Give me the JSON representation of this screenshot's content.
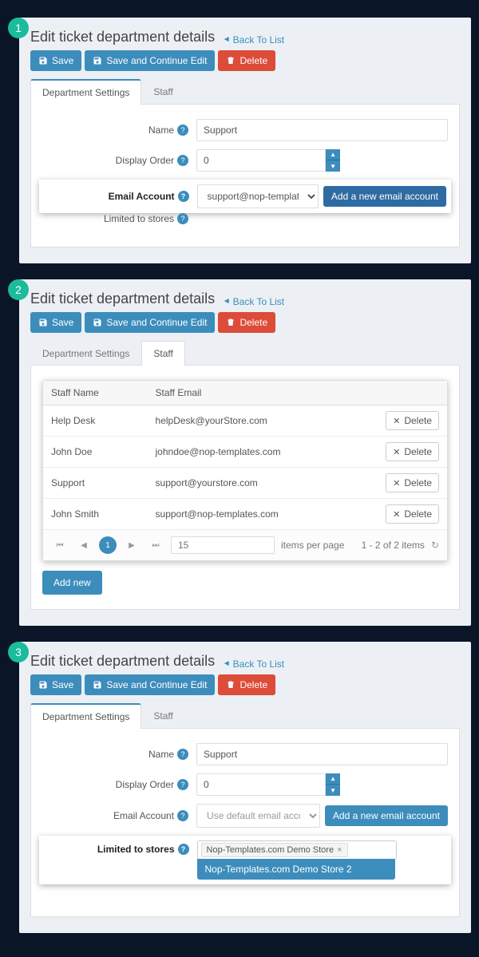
{
  "common": {
    "page_title": "Edit ticket department details",
    "back_link": "Back To List",
    "save": "Save",
    "save_continue": "Save and Continue Edit",
    "delete": "Delete",
    "tab_settings": "Department Settings",
    "tab_staff": "Staff",
    "label_name": "Name",
    "label_display_order": "Display Order",
    "label_email_account": "Email Account",
    "label_limited_stores": "Limited to stores",
    "btn_add_email": "Add a new email account"
  },
  "p1": {
    "num": "1",
    "name_value": "Support",
    "display_order": "0",
    "email_select": "support@nop-templates.com"
  },
  "p2": {
    "num": "2",
    "col_name": "Staff Name",
    "col_email": "Staff Email",
    "row_delete": "Delete",
    "rows": [
      {
        "name": "Help Desk",
        "email": "helpDesk@yourStore.com"
      },
      {
        "name": "John Doe",
        "email": "johndoe@nop-templates.com"
      },
      {
        "name": "Support",
        "email": "support@yourstore.com"
      },
      {
        "name": "John Smith",
        "email": "support@nop-templates.com"
      }
    ],
    "page_current": "1",
    "per_page": "15",
    "per_page_label": "items per page",
    "summary": "1 - 2 of 2 items",
    "add_new": "Add new"
  },
  "p3": {
    "num": "3",
    "name_value": "Support",
    "display_order": "0",
    "email_select": "Use default email account ( from plugin settings )",
    "store_token": "Nop-Templates.com Demo Store",
    "store_option": "Nop-Templates.com Demo Store 2"
  }
}
